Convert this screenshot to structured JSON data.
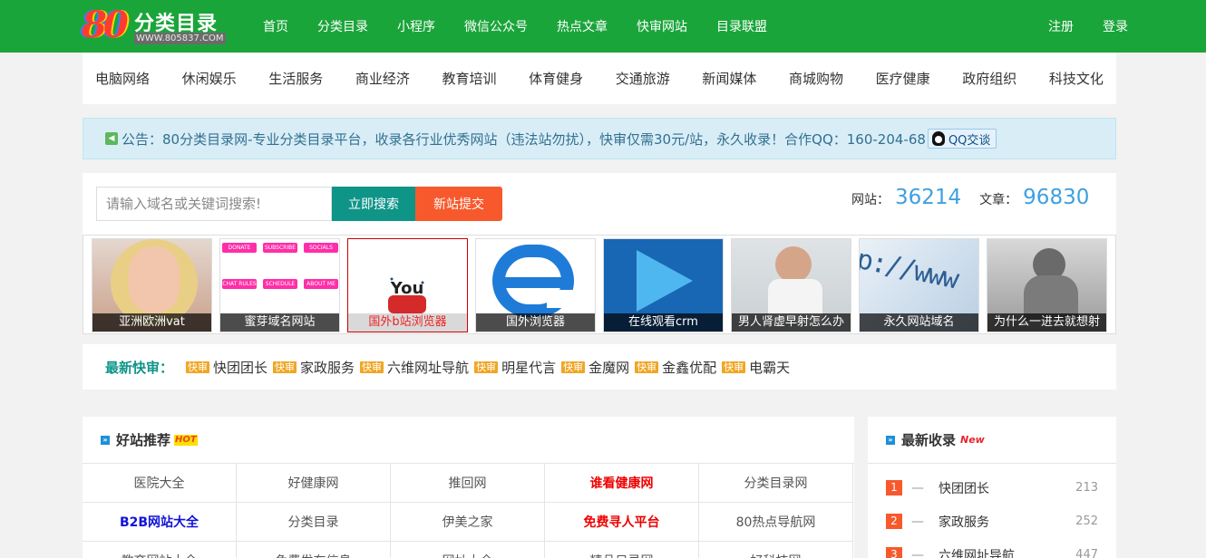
{
  "logo": {
    "mark": "80",
    "name": "分类目录",
    "url": "WWW.805837.COM"
  },
  "nav": {
    "items": [
      "首页",
      "分类目录",
      "小程序",
      "微信公众号",
      "热点文章",
      "快审网站",
      "目录联盟"
    ],
    "register": "注册",
    "login": "登录"
  },
  "categories": [
    "电脑网络",
    "休闲娱乐",
    "生活服务",
    "商业经济",
    "教育培训",
    "体育健身",
    "交通旅游",
    "新闻媒体",
    "商城购物",
    "医疗健康",
    "政府组织",
    "科技文化"
  ],
  "notice": {
    "text": "公告：80分类目录网-专业分类目录平台，收录各行业优秀网站（违法站勿扰），快审仅需30元/站，永久收录！合作QQ：160-204-68",
    "qq_label": "QQ交谈"
  },
  "search": {
    "placeholder": "请输入域名或关键词搜索!",
    "search_button": "立即搜索",
    "submit_button": "新站提交"
  },
  "stats": {
    "sites_label": "网站：",
    "sites_value": "36214",
    "articles_label": "文章：",
    "articles_value": "96830"
  },
  "thumbnails": [
    {
      "caption": "亚洲欧洲vat"
    },
    {
      "caption": "蜜芽域名网站"
    },
    {
      "caption": "国外b站浏览器"
    },
    {
      "caption": "国外浏览器"
    },
    {
      "caption": "在线观看crm"
    },
    {
      "caption": "男人肾虚早射怎么办"
    },
    {
      "caption": "永久网站域名"
    },
    {
      "caption": "为什么一进去就想射"
    }
  ],
  "thumb_pills": [
    "DONATE",
    "SUBSCRIBE",
    "SOCIALS",
    "CHAT RULES",
    "SCHEDULE",
    "ABOUT ME"
  ],
  "thumb_url_text": "p://www",
  "latest": {
    "label": "最新快审：",
    "badge": "快审",
    "items": [
      "快团团长",
      "家政服务",
      "六维网址导航",
      "明星代言",
      "金魔网",
      "金鑫优配",
      "电霸天"
    ]
  },
  "good_sites": {
    "title": "好站推荐",
    "hot": "HOT",
    "rows": [
      [
        "医院大全",
        "好健康网",
        "推回网",
        "谁看健康网",
        "分类目录网"
      ],
      [
        "B2B网站大全",
        "分类目录",
        "伊美之家",
        "免费寻人平台",
        "80热点导航网"
      ],
      [
        "教育网站大全",
        "免费发布信息",
        "网址大全",
        "精品目录网",
        "好科技网"
      ]
    ]
  },
  "newest": {
    "title": "最新收录",
    "new_tag": "New",
    "items": [
      {
        "rank": "1",
        "name": "快团团长",
        "count": "213"
      },
      {
        "rank": "2",
        "name": "家政服务",
        "count": "252"
      },
      {
        "rank": "3",
        "name": "六维网址导航",
        "count": "447"
      }
    ]
  },
  "colors": {
    "brand_green": "#1aa53a",
    "teal": "#0f9488",
    "orange": "#f7592d",
    "stat_blue": "#3fa0e0"
  }
}
